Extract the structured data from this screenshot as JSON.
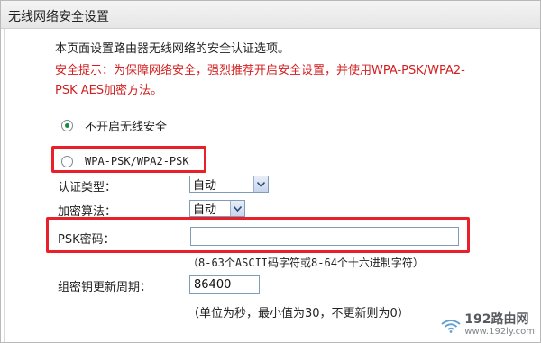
{
  "header": {
    "title": "无线网络安全设置"
  },
  "intro": {
    "description": "本页面设置路由器无线网络的安全认证选项。",
    "warning": "安全提示：为保障网络安全，强烈推荐开启安全设置，并使用WPA-PSK/WPA2-PSK AES加密方法。"
  },
  "security_mode": {
    "options": [
      {
        "label": "不开启无线安全",
        "checked": true
      },
      {
        "label": "WPA-PSK/WPA2-PSK",
        "checked": false
      }
    ]
  },
  "wpa": {
    "auth_type_label": "认证类型：",
    "auth_type_value": "自动",
    "encryption_label": "加密算法：",
    "encryption_value": "自动",
    "psk_label": "PSK密码：",
    "psk_value": "",
    "psk_hint": "（8-63个ASCII码字符或8-64个十六进制字符）",
    "rekey_label": "组密钥更新周期：",
    "rekey_value": "86400",
    "rekey_hint": "（单位为秒，最小值为30，不更新则为0）"
  },
  "watermark": {
    "main": "192路由网",
    "sub": "www.192ly.com"
  },
  "colors": {
    "highlight": "#e8202a",
    "warning_text": "#d22020",
    "radio_dot": "#1d8b3a"
  }
}
